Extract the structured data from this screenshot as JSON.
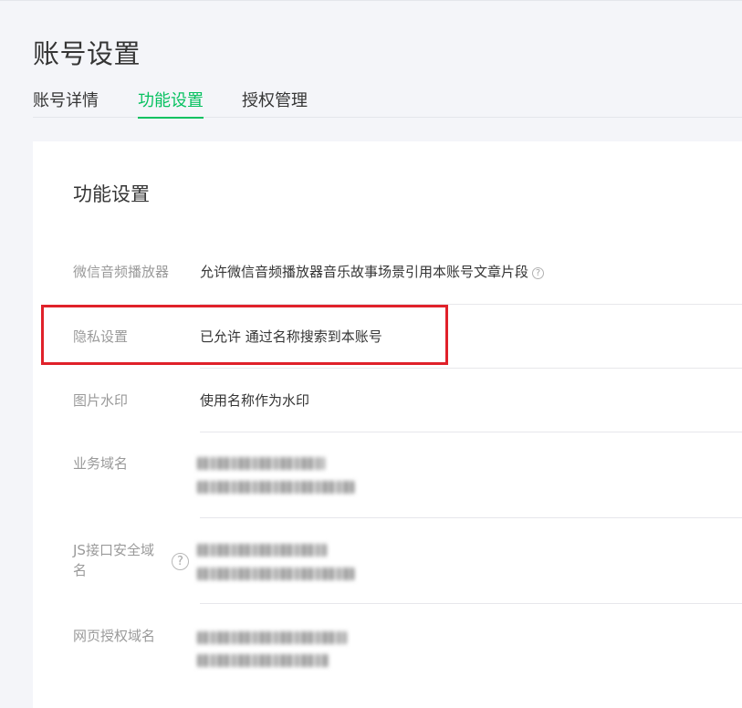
{
  "page": {
    "title": "账号设置"
  },
  "tabs": [
    {
      "label": "账号详情",
      "active": false
    },
    {
      "label": "功能设置",
      "active": true
    },
    {
      "label": "授权管理",
      "active": false
    }
  ],
  "section": {
    "title": "功能设置",
    "rows": [
      {
        "label": "微信音频播放器",
        "value": "允许微信音频播放器音乐故事场景引用本账号文章片段",
        "help_icon": "question-circle-icon"
      },
      {
        "label": "隐私设置",
        "value": "已允许 通过名称搜索到本账号"
      },
      {
        "label": "图片水印",
        "value": "使用名称作为水印"
      },
      {
        "label": "业务域名",
        "value_hidden": true
      },
      {
        "label_line1": "JS接口安全域",
        "label_line2": "名",
        "value_hidden": true,
        "help_icon": "question-circle-icon"
      },
      {
        "label": "网页授权域名",
        "value_hidden": true
      }
    ]
  },
  "help_glyph": "?",
  "colors": {
    "accent": "#07c160",
    "highlight": "#e0212a",
    "label": "#9a9a9a",
    "text": "#353535"
  }
}
